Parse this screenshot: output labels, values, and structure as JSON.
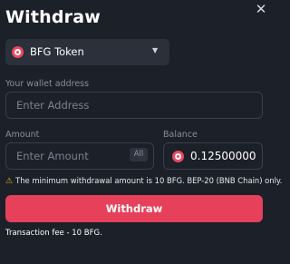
{
  "dialog": {
    "title": "Withdraw",
    "close_icon": "close-icon"
  },
  "token_select": {
    "selected": "BFG Token",
    "icon": "bfg-token-icon",
    "chevron_icon": "chevron-down-icon"
  },
  "wallet": {
    "label": "Your wallet address",
    "placeholder": "Enter Address",
    "value": ""
  },
  "amount": {
    "label": "Amount",
    "placeholder": "Enter Amount",
    "value": "",
    "all_label": "All"
  },
  "balance": {
    "label": "Balance",
    "value": "0.12500000"
  },
  "notice": {
    "icon": "warning-icon",
    "text": "The minimum withdrawal amount is 10 BFG. BEP-20 (BNB Chain) only."
  },
  "actions": {
    "withdraw_label": "Withdraw"
  },
  "fee": {
    "text": "Transaction fee - 10 BFG."
  },
  "colors": {
    "background": "#1c2029",
    "accent": "#e6405a",
    "warning": "#f5b400"
  }
}
